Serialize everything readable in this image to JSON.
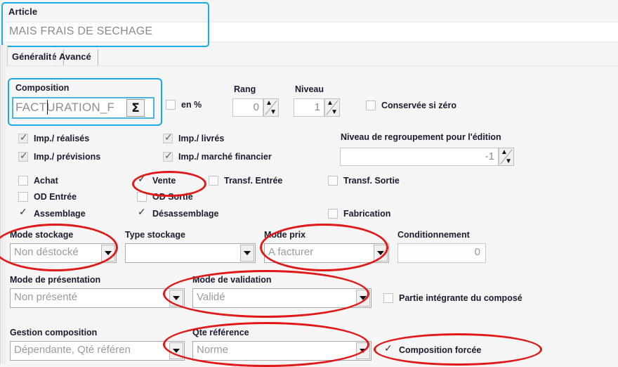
{
  "window": {
    "background": "#f5f5f5",
    "highlight_color": "#17a9e8",
    "annotation_color": "#e01818"
  },
  "article": {
    "label": "Article",
    "value": "MAIS FRAIS DE SECHAGE"
  },
  "tabs": [
    {
      "label": "Généralité",
      "active": true
    },
    {
      "label": "Avancé",
      "active": false
    }
  ],
  "composition": {
    "label": "Composition",
    "value": "FACTURATION_F",
    "sigma_button": "Σ"
  },
  "en_percent": {
    "label": "en %",
    "checked": false
  },
  "rang": {
    "label": "Rang",
    "value": "0"
  },
  "niveau": {
    "label": "Niveau",
    "value": "1"
  },
  "conservee": {
    "label": "Conservée si zéro",
    "checked": false
  },
  "regroupement": {
    "label": "Niveau de regroupement pour l'édition",
    "value": "-1"
  },
  "imp_checks": [
    {
      "label": "Imp./ réalisés",
      "checked": true,
      "disabled": true
    },
    {
      "label": "Imp./ livrés",
      "checked": true,
      "disabled": true
    },
    {
      "label": "Imp./ prévisions",
      "checked": true,
      "disabled": true
    },
    {
      "label": "Imp./ marché financier",
      "checked": true,
      "disabled": true
    }
  ],
  "flow_checks": [
    {
      "label": "Achat",
      "checked": false
    },
    {
      "label": "Vente",
      "checked": true
    },
    {
      "label": "Transf. Entrée",
      "checked": false
    },
    {
      "label": "Transf. Sortie",
      "checked": false
    },
    {
      "label": "OD Entrée",
      "checked": false
    },
    {
      "label": "OD Sortie",
      "checked": false
    },
    {
      "label": "Assemblage",
      "checked": true
    },
    {
      "label": "Désassemblage",
      "checked": true
    },
    {
      "label": "Fabrication",
      "checked": false
    }
  ],
  "mode_stockage": {
    "label": "Mode stockage",
    "value": "Non déstocké"
  },
  "type_stockage": {
    "label": "Type stockage",
    "value": ""
  },
  "mode_prix": {
    "label": "Mode prix",
    "value": "A facturer"
  },
  "conditionnement": {
    "label": "Conditionnement",
    "value": "0"
  },
  "mode_presentation": {
    "label": "Mode de présentation",
    "value": "Non présenté"
  },
  "mode_validation": {
    "label": "Mode de validation",
    "value": "Validé"
  },
  "partie_integrante": {
    "label": "Partie intégrante du composé",
    "checked": false
  },
  "gestion_composition": {
    "label": "Gestion composition",
    "value": "Dépendante, Qté référen"
  },
  "qte_reference": {
    "label": "Qte référence",
    "value": "Norme"
  },
  "composition_forcee": {
    "label": "Composition forcée",
    "checked": true
  },
  "icons": {
    "spin_up": "▲",
    "spin_down": "▼",
    "dropdown": "chevron-down-icon"
  }
}
